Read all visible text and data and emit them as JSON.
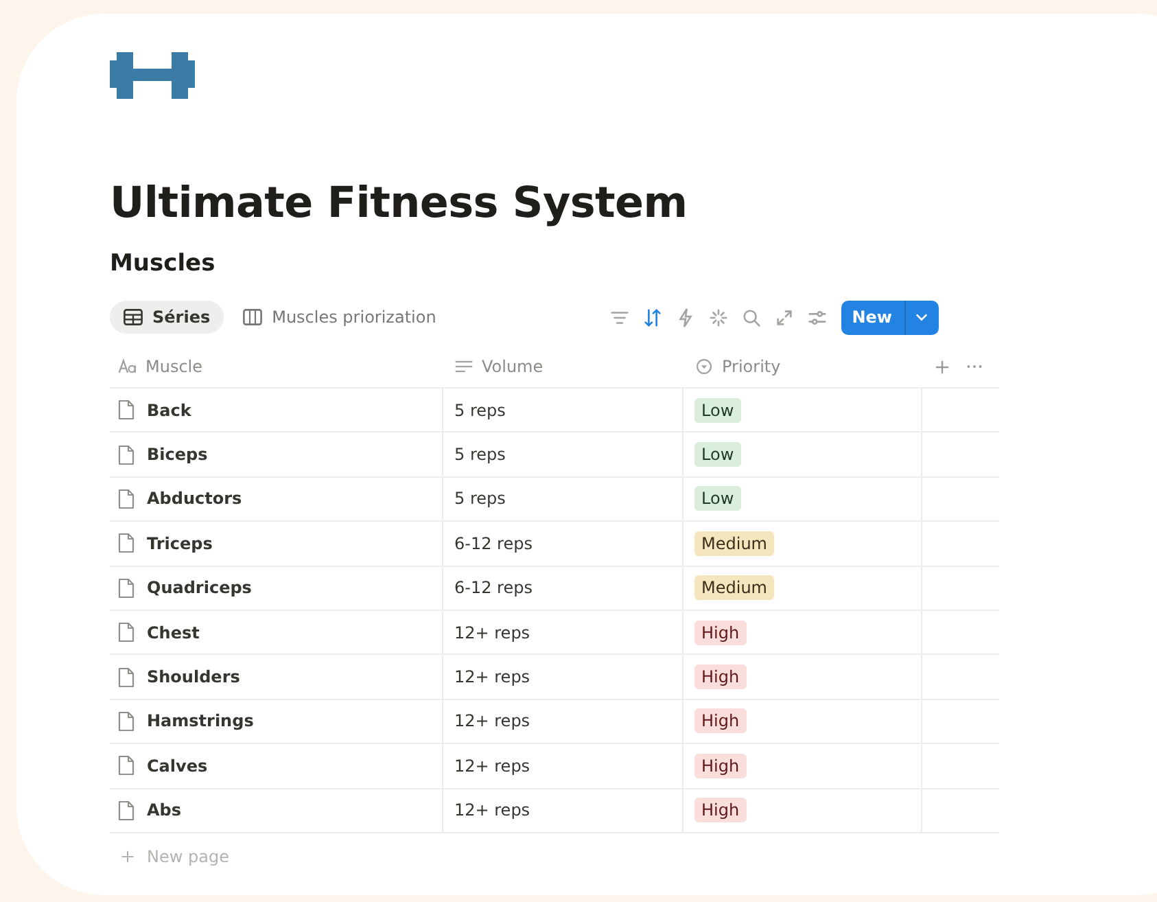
{
  "page": {
    "title": "Ultimate Fitness System",
    "database_title": "Muscles"
  },
  "views": [
    {
      "label": "Séries",
      "kind": "table",
      "selected": true
    },
    {
      "label": "Muscles priorization",
      "kind": "board",
      "selected": false
    }
  ],
  "toolbar": [
    {
      "kind": "filter",
      "active": false
    },
    {
      "kind": "sort",
      "active": true
    },
    {
      "kind": "bolt",
      "active": false
    },
    {
      "kind": "sparkle",
      "active": false
    },
    {
      "kind": "search",
      "active": false
    },
    {
      "kind": "expand",
      "active": false
    },
    {
      "kind": "sliders",
      "active": false
    }
  ],
  "new_button": {
    "label": "New"
  },
  "table": {
    "columns": [
      {
        "label": "Muscle",
        "kind": "title"
      },
      {
        "label": "Volume",
        "kind": "text"
      },
      {
        "label": "Priority",
        "kind": "select"
      }
    ],
    "rows": [
      {
        "muscle": "Back",
        "volume": "5 reps",
        "priority": {
          "label": "Low",
          "color": "#dbeddb"
        }
      },
      {
        "muscle": "Biceps",
        "volume": "5 reps",
        "priority": {
          "label": "Low",
          "color": "#dbeddb"
        }
      },
      {
        "muscle": "Abductors",
        "volume": "5 reps",
        "priority": {
          "label": "Low",
          "color": "#dbeddb"
        }
      },
      {
        "muscle": "Triceps",
        "volume": "6-12 reps",
        "priority": {
          "label": "Medium",
          "color": "#f6e6bd"
        }
      },
      {
        "muscle": "Quadriceps",
        "volume": "6-12 reps",
        "priority": {
          "label": "Medium",
          "color": "#f6e6bd"
        }
      },
      {
        "muscle": "Chest",
        "volume": "12+ reps",
        "priority": {
          "label": "High",
          "color": "#fadedc"
        }
      },
      {
        "muscle": "Shoulders",
        "volume": "12+ reps",
        "priority": {
          "label": "High",
          "color": "#fadedc"
        }
      },
      {
        "muscle": "Hamstrings",
        "volume": "12+ reps",
        "priority": {
          "label": "High",
          "color": "#fadedc"
        }
      },
      {
        "muscle": "Calves",
        "volume": "12+ reps",
        "priority": {
          "label": "High",
          "color": "#fadedc"
        }
      },
      {
        "muscle": "Abs",
        "volume": "12+ reps",
        "priority": {
          "label": "High",
          "color": "#fadedc"
        }
      }
    ],
    "new_row": {
      "label": "New page"
    }
  }
}
